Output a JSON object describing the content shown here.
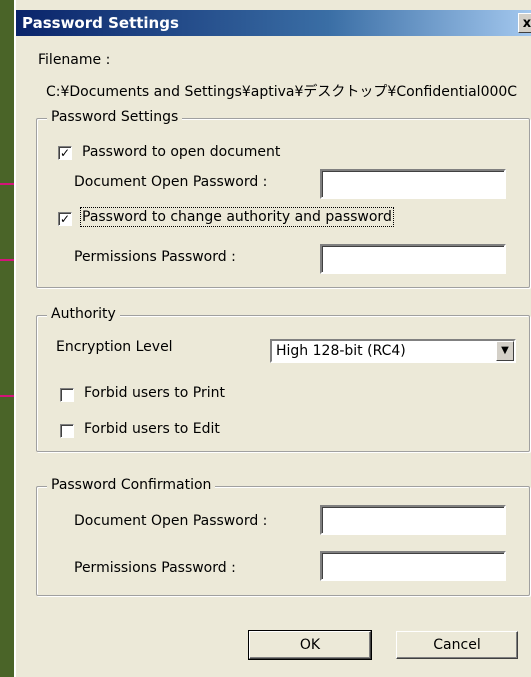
{
  "window": {
    "title": "Password Settings",
    "close_glyph": "x"
  },
  "filename": {
    "label": "Filename :",
    "path": "C:¥Documents and Settings¥aptiva¥デスクトップ¥Confidential000C"
  },
  "password_settings": {
    "legend": "Password Settings",
    "open_checkbox_label": "Password to open document",
    "open_checked": true,
    "open_password_label": "Document Open Password :",
    "change_checkbox_label": "Password to change authority and password",
    "change_checked": true,
    "permissions_password_label": "Permissions Password :"
  },
  "authority": {
    "legend": "Authority",
    "encryption_label": "Encryption Level",
    "encryption_value": "High 128-bit (RC4)",
    "forbid_print_label": "Forbid users to Print",
    "forbid_print_checked": false,
    "forbid_edit_label": "Forbid users to Edit",
    "forbid_edit_checked": false
  },
  "confirmation": {
    "legend": "Password Confirmation",
    "open_password_label": "Document Open Password :",
    "permissions_password_label": "Permissions Password :"
  },
  "buttons": {
    "ok": "OK",
    "cancel": "Cancel"
  },
  "colors": {
    "annotation_arrow": "#d4147a",
    "title_bar": "#0a246a",
    "background": "#4a6428"
  }
}
